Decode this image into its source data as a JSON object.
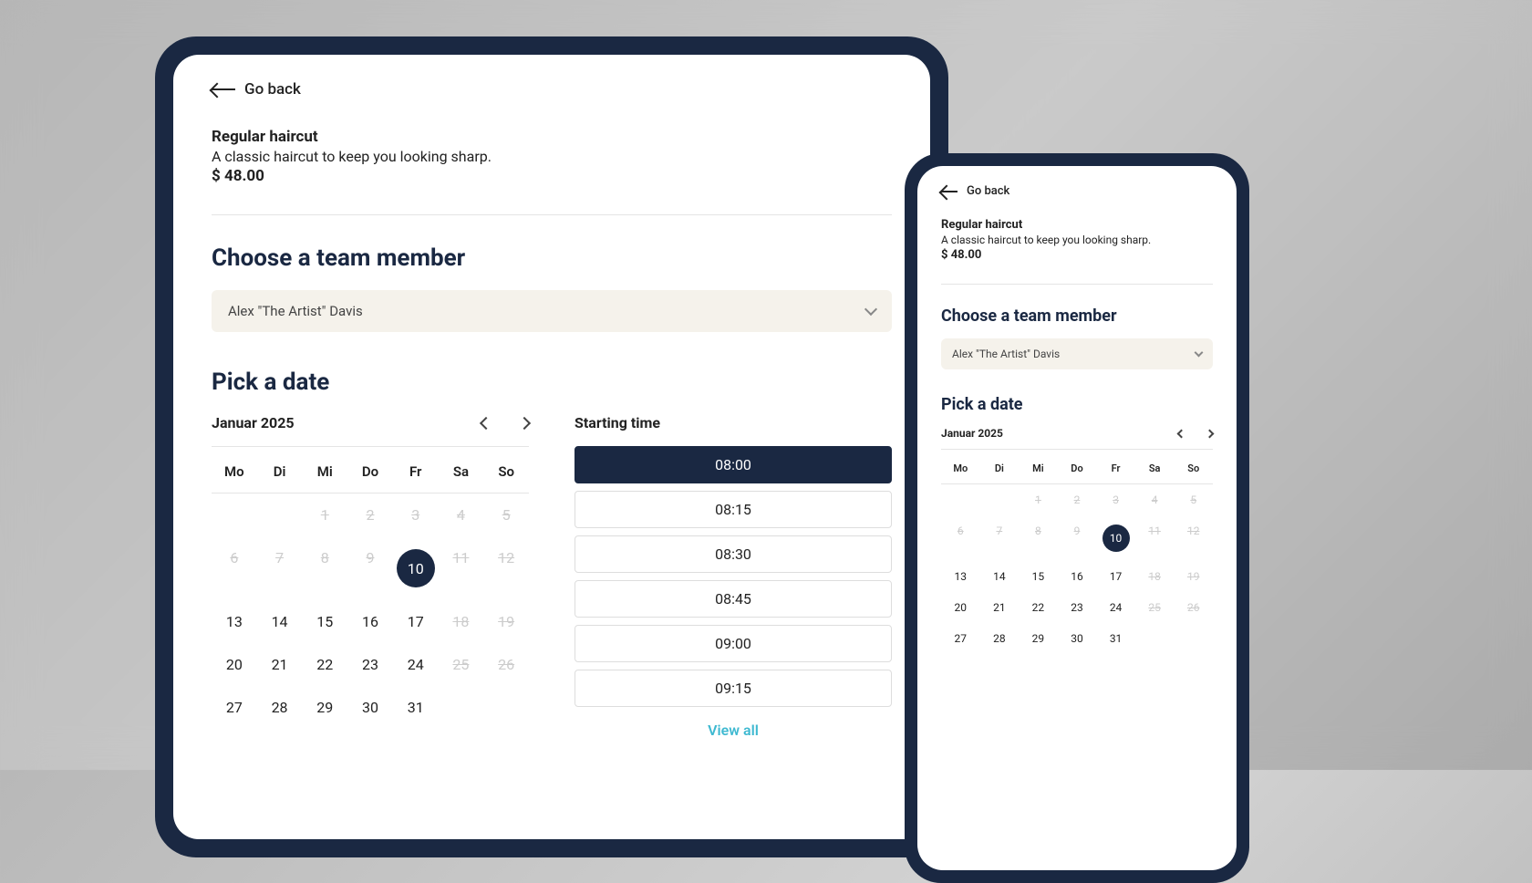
{
  "goBack": "Go back",
  "service": {
    "title": "Regular haircut",
    "description": "A classic haircut to keep you looking sharp.",
    "price": "$ 48.00"
  },
  "sections": {
    "chooseTeam": "Choose a team member",
    "pickDate": "Pick a date",
    "startingTime": "Starting time",
    "viewAll": "View all"
  },
  "teamMember": {
    "selected": "Alex \"The Artist\" Davis"
  },
  "calendar": {
    "monthLabel": "Januar 2025",
    "dow": [
      "Mo",
      "Di",
      "Mi",
      "Do",
      "Fr",
      "Sa",
      "So"
    ],
    "days": [
      {
        "n": "",
        "d": false
      },
      {
        "n": "",
        "d": false
      },
      {
        "n": "1",
        "d": true
      },
      {
        "n": "2",
        "d": true
      },
      {
        "n": "3",
        "d": true
      },
      {
        "n": "4",
        "d": true
      },
      {
        "n": "5",
        "d": true
      },
      {
        "n": "6",
        "d": true
      },
      {
        "n": "7",
        "d": true
      },
      {
        "n": "8",
        "d": true
      },
      {
        "n": "9",
        "d": true
      },
      {
        "n": "10",
        "d": false,
        "sel": true
      },
      {
        "n": "11",
        "d": true
      },
      {
        "n": "12",
        "d": true
      },
      {
        "n": "13",
        "d": false
      },
      {
        "n": "14",
        "d": false
      },
      {
        "n": "15",
        "d": false
      },
      {
        "n": "16",
        "d": false
      },
      {
        "n": "17",
        "d": false
      },
      {
        "n": "18",
        "d": true
      },
      {
        "n": "19",
        "d": true
      },
      {
        "n": "20",
        "d": false
      },
      {
        "n": "21",
        "d": false
      },
      {
        "n": "22",
        "d": false
      },
      {
        "n": "23",
        "d": false
      },
      {
        "n": "24",
        "d": false
      },
      {
        "n": "25",
        "d": true
      },
      {
        "n": "26",
        "d": true
      },
      {
        "n": "27",
        "d": false
      },
      {
        "n": "28",
        "d": false
      },
      {
        "n": "29",
        "d": false
      },
      {
        "n": "30",
        "d": false
      },
      {
        "n": "31",
        "d": false
      }
    ]
  },
  "timeSlots": [
    {
      "time": "08:00",
      "selected": true
    },
    {
      "time": "08:15",
      "selected": false
    },
    {
      "time": "08:30",
      "selected": false
    },
    {
      "time": "08:45",
      "selected": false
    },
    {
      "time": "09:00",
      "selected": false
    },
    {
      "time": "09:15",
      "selected": false
    }
  ]
}
